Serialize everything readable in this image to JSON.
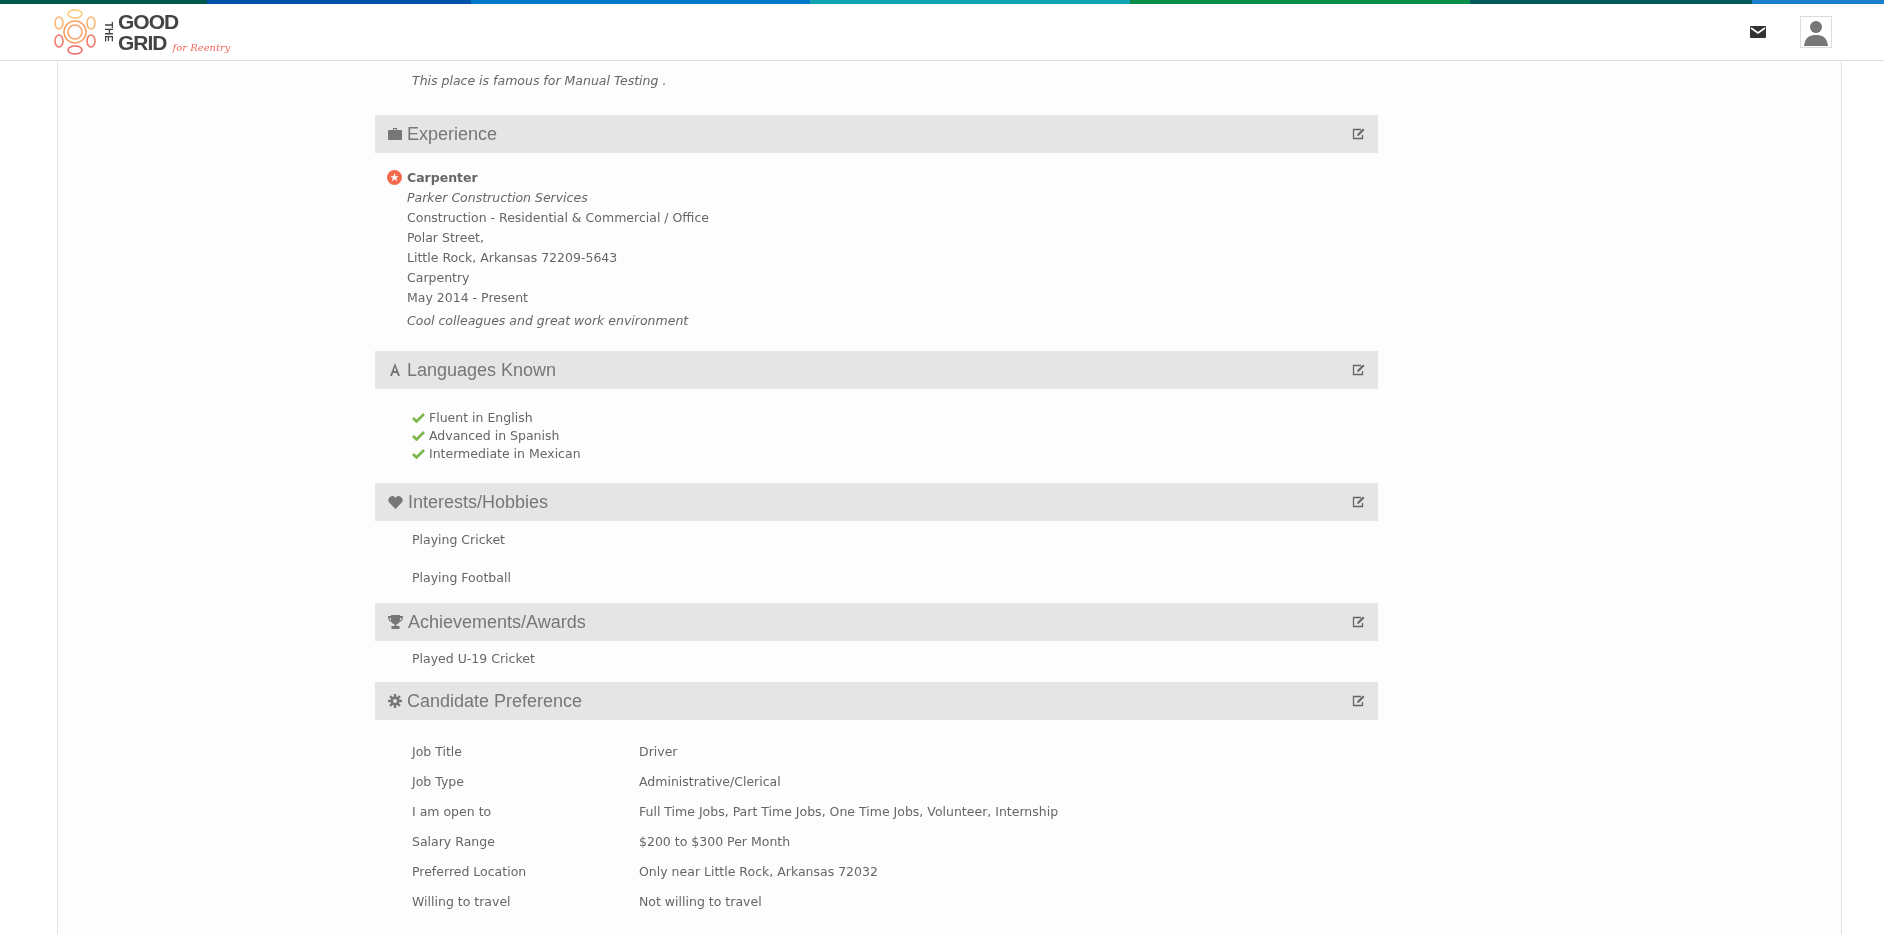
{
  "header": {
    "logo": {
      "the": "THE",
      "good": "GOOD",
      "grid": "GRID",
      "tagline": "for Reentry"
    }
  },
  "previous_entry": {
    "note": "This place is famous for Manual Testing ."
  },
  "sections": [
    {
      "kind": "experience",
      "title": "Experience",
      "jobs": [
        {
          "title": "Carpenter",
          "company": "Parker Construction Services",
          "lines": [
            "Construction - Residential & Commercial / Office",
            "Polar Street,",
            "Little Rock, Arkansas  72209-5643",
            "Carpentry",
            "May 2014 - Present"
          ],
          "note": "Cool colleagues and great work environment"
        }
      ]
    },
    {
      "kind": "languages",
      "title": "Languages Known",
      "items": [
        "Fluent in English",
        "Advanced in Spanish",
        "Intermediate in Mexican"
      ]
    },
    {
      "kind": "interests",
      "title": "Interests/Hobbies",
      "items": [
        "Playing Cricket",
        "Playing Football"
      ]
    },
    {
      "kind": "achievements",
      "title": "Achievements/Awards",
      "items": [
        "Played U-19 Cricket"
      ]
    },
    {
      "kind": "preference",
      "title": "Candidate Preference",
      "rows": [
        {
          "label": "Job Title",
          "value": "Driver"
        },
        {
          "label": "Job Type",
          "value": "Administrative/Clerical"
        },
        {
          "label": "I am open to",
          "value": "Full Time Jobs, Part Time Jobs, One Time Jobs, Volunteer, Internship"
        },
        {
          "label": "Salary Range",
          "value": "$200 to $300 Per Month"
        },
        {
          "label": "Preferred Location",
          "value": "Only near Little Rock, Arkansas 72032"
        },
        {
          "label": "Willing to travel",
          "value": "Not willing to travel"
        }
      ]
    }
  ]
}
